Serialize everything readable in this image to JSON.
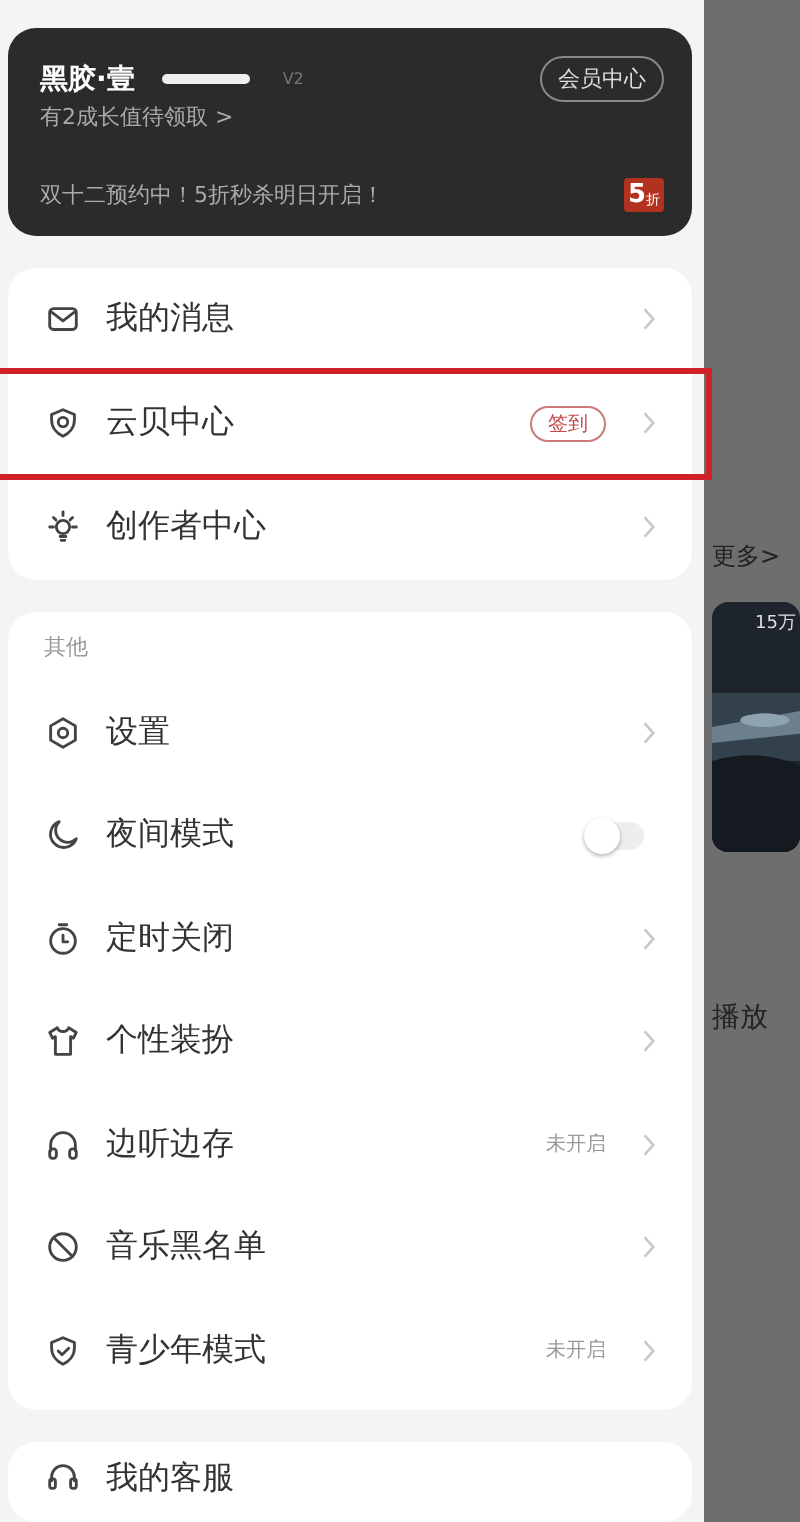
{
  "vip_card": {
    "name": "黑胶·壹",
    "level_badge": "V2",
    "member_button": "会员中心",
    "growth_link": "有2成长值待领取 >",
    "promo": "双十二预约中！5折秒杀明日开启！",
    "promo_badge": "5",
    "promo_badge_sub": "折"
  },
  "main_menu": [
    {
      "label": "我的消息",
      "highlighted": false
    },
    {
      "label": "云贝中心",
      "badge": "签到",
      "highlighted": true
    },
    {
      "label": "创作者中心",
      "highlighted": false
    }
  ],
  "other_section": {
    "title": "其他",
    "items": [
      {
        "kind": "link",
        "label": "设置"
      },
      {
        "kind": "toggle",
        "label": "夜间模式",
        "on": false
      },
      {
        "kind": "link",
        "label": "定时关闭"
      },
      {
        "kind": "link",
        "label": "个性装扮"
      },
      {
        "kind": "link",
        "label": "边听边存",
        "value": "未开启"
      },
      {
        "kind": "link",
        "label": "音乐黑名单"
      },
      {
        "kind": "link",
        "label": "青少年模式",
        "value": "未开启"
      }
    ]
  },
  "bottom_menu": [
    {
      "label": "我的客服"
    }
  ],
  "background": {
    "more_link": "更多>",
    "play_count": "15万",
    "play_label": "播放"
  }
}
